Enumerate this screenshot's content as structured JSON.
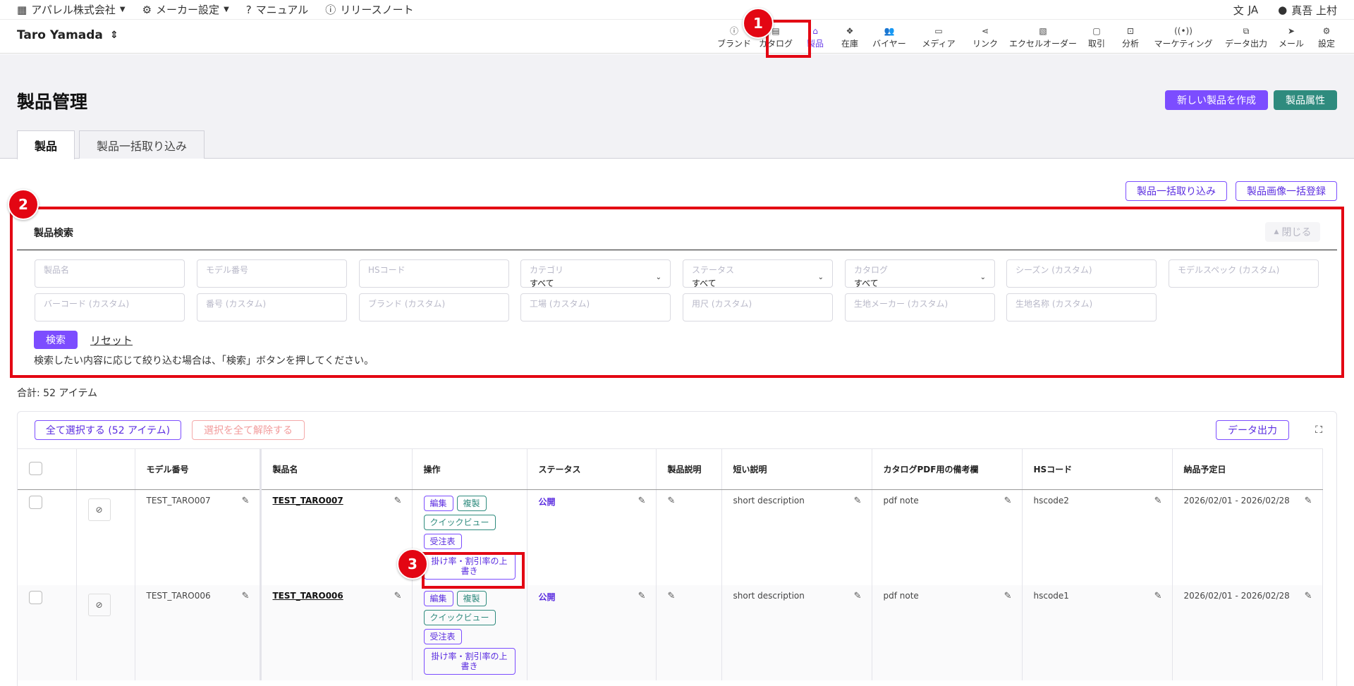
{
  "topbar": {
    "company": "アパレル株式会社",
    "maker_settings": "メーカー設定",
    "manual": "マニュアル",
    "release_notes": "リリースノート",
    "language": "JA",
    "user": "真吾 上村"
  },
  "nav": {
    "account": "Taro Yamada",
    "items": [
      {
        "label": "ブランド",
        "icon": "info-icon"
      },
      {
        "label": "カタログ",
        "icon": "catalog-icon"
      },
      {
        "label": "製品",
        "icon": "hanger-icon"
      },
      {
        "label": "在庫",
        "icon": "boxes-icon"
      },
      {
        "label": "バイヤー",
        "icon": "users-icon"
      },
      {
        "label": "メディア",
        "icon": "cast-icon"
      },
      {
        "label": "リンク",
        "icon": "share-icon"
      },
      {
        "label": "エクセルオーダー",
        "icon": "excel-icon"
      },
      {
        "label": "取引",
        "icon": "message-icon"
      },
      {
        "label": "分析",
        "icon": "chart-icon"
      },
      {
        "label": "マーケティング",
        "icon": "broadcast-icon"
      },
      {
        "label": "データ出力",
        "icon": "copy-icon"
      },
      {
        "label": "メール",
        "icon": "send-icon"
      },
      {
        "label": "設定",
        "icon": "gear-icon"
      }
    ],
    "active": "製品"
  },
  "page": {
    "title": "製品管理",
    "new_product": "新しい製品を作成",
    "product_attributes": "製品属性",
    "tabs": [
      "製品",
      "製品一括取り込み"
    ],
    "bulk_import": "製品一括取り込み",
    "bulk_image": "製品画像一括登録"
  },
  "search": {
    "title": "製品検索",
    "close": "閉じる",
    "fields": {
      "product_name": "製品名",
      "model_number": "モデル番号",
      "hs_code": "HSコード",
      "category": "カテゴリ",
      "category_value": "すべて",
      "status": "ステータス",
      "status_value": "すべて",
      "catalog": "カタログ",
      "catalog_value": "すべて",
      "season": "シーズン (カスタム)",
      "model_spec": "モデルスペック (カスタム)",
      "barcode": "バーコード (カスタム)",
      "number": "番号 (カスタム)",
      "brand": "ブランド (カスタム)",
      "factory": "工場 (カスタム)",
      "fabric_length": "用尺 (カスタム)",
      "fabric_maker": "生地メーカー (カスタム)",
      "fabric_name": "生地名称 (カスタム)"
    },
    "search_button": "検索",
    "reset": "リセット",
    "hint": "検索したい内容に応じて絞り込む場合は、「検索」ボタンを押してください。"
  },
  "total": "合計:  52 アイテム",
  "table": {
    "select_all": "全て選択する (52 アイテム)",
    "deselect_all": "選択を全て解除する",
    "export": "データ出力",
    "headers": [
      "モデル番号",
      "製品名",
      "操作",
      "ステータス",
      "製品説明",
      "短い説明",
      "カタログPDF用の備考欄",
      "HSコード",
      "納品予定日"
    ],
    "actions": {
      "edit": "編集",
      "copy": "複製",
      "quick_view": "クイックビュー",
      "order_sheet": "受注表",
      "override": "掛け率・割引率の上書き"
    },
    "rows": [
      {
        "model": "TEST_TARO007",
        "name": "TEST_TARO007",
        "status": "公開",
        "short_desc": "short description",
        "pdf_note": "pdf note",
        "hs_code": "hscode2",
        "delivery": "2026/02/01 - 2026/02/28"
      },
      {
        "model": "TEST_TARO006",
        "name": "TEST_TARO006",
        "status": "公開",
        "short_desc": "short description",
        "pdf_note": "pdf note",
        "hs_code": "hscode1",
        "delivery": "2026/02/01 - 2026/02/28"
      }
    ]
  },
  "annotations": [
    "1",
    "2",
    "3"
  ],
  "colors": {
    "accent": "#7c4dff",
    "teal": "#2f8b7e",
    "annotation": "#e30613"
  }
}
